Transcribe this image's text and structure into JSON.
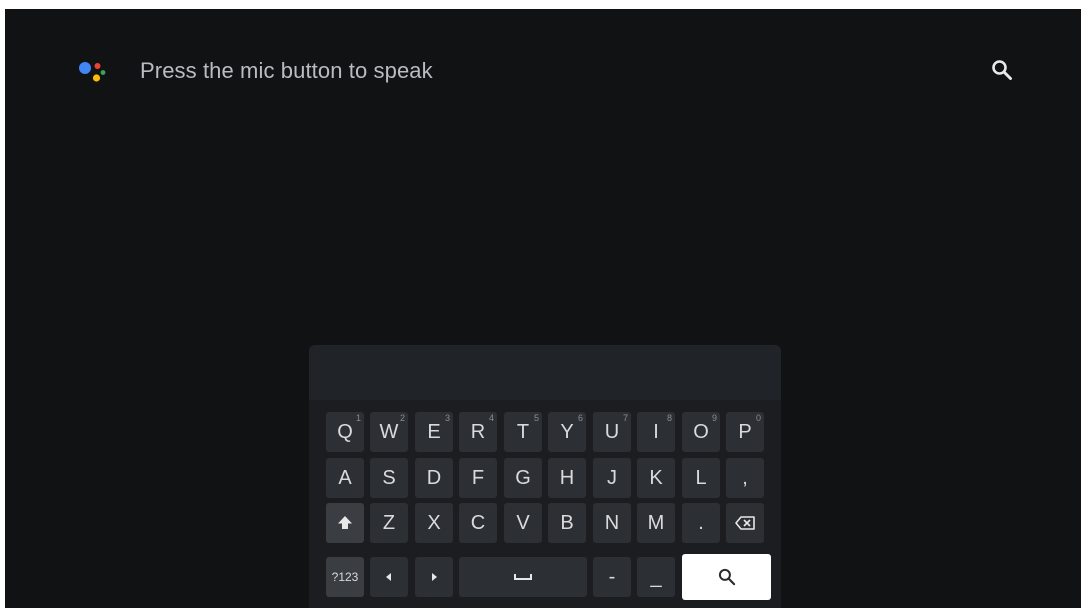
{
  "header": {
    "prompt": "Press the mic button to speak",
    "assistant_colors": [
      "#4285F4",
      "#EA4335",
      "#FBBC05",
      "#34A853"
    ]
  },
  "keyboard": {
    "row1": [
      {
        "key": "Q",
        "hint": "1"
      },
      {
        "key": "W",
        "hint": "2"
      },
      {
        "key": "E",
        "hint": "3"
      },
      {
        "key": "R",
        "hint": "4"
      },
      {
        "key": "T",
        "hint": "5"
      },
      {
        "key": "Y",
        "hint": "6"
      },
      {
        "key": "U",
        "hint": "7"
      },
      {
        "key": "I",
        "hint": "8"
      },
      {
        "key": "O",
        "hint": "9"
      },
      {
        "key": "P",
        "hint": "0"
      }
    ],
    "row2": [
      "A",
      "S",
      "D",
      "F",
      "G",
      "H",
      "J",
      "K",
      "L",
      ","
    ],
    "row3": [
      "Z",
      "X",
      "C",
      "V",
      "B",
      "N",
      "M",
      "."
    ],
    "symbols_label": "?123",
    "dash": "-",
    "underscore": "_",
    "shift_icon": "shift-icon",
    "backspace_icon": "backspace-icon",
    "left_icon": "arrow-left-icon",
    "right_icon": "arrow-right-icon",
    "space_icon": "space-icon",
    "search_icon": "search-icon"
  }
}
